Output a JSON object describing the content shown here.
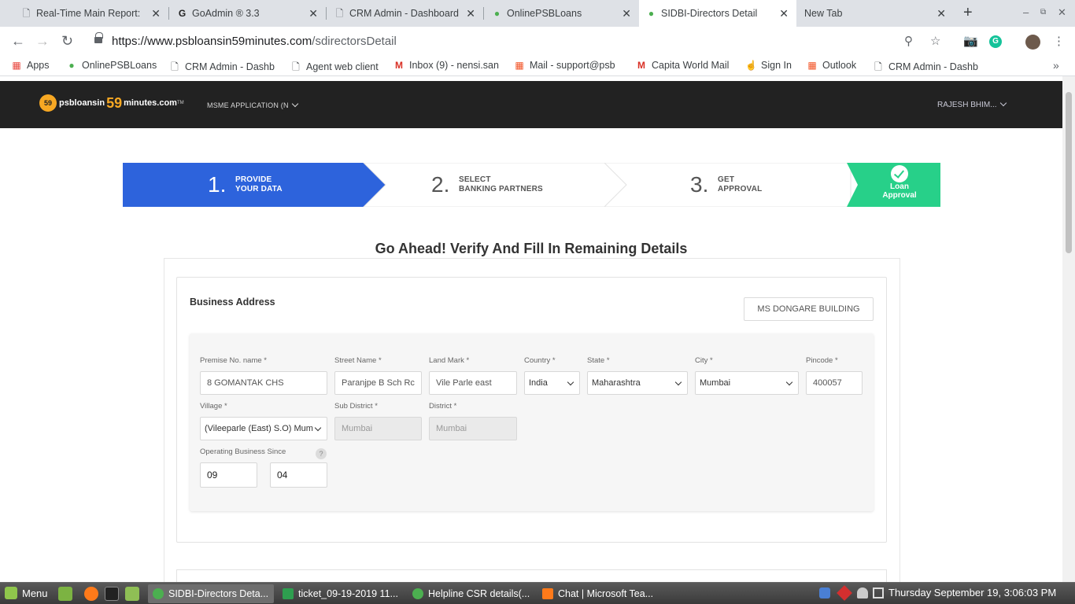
{
  "browser": {
    "tabs": [
      {
        "title": "Real-Time Main Report: ",
        "icon": "page-icon"
      },
      {
        "title": "GoAdmin ® 3.3",
        "icon": "goadmin-icon"
      },
      {
        "title": "CRM Admin - Dashboard",
        "icon": "page-icon"
      },
      {
        "title": "OnlinePSBLoans",
        "icon": "psb-icon"
      },
      {
        "title": "SIDBI-Directors Detail",
        "icon": "psb-icon"
      },
      {
        "title": "New Tab",
        "icon": ""
      }
    ],
    "url_host": "https://www.psbloansin59minutes.com",
    "url_path": "/sdirectorsDetail",
    "bookmarks": [
      {
        "label": "Apps"
      },
      {
        "label": "OnlinePSBLoans"
      },
      {
        "label": "CRM Admin - Dashb"
      },
      {
        "label": "Agent web client"
      },
      {
        "label": "Inbox (9) - nensi.san"
      },
      {
        "label": "Mail - support@psb"
      },
      {
        "label": "Capita World Mail"
      },
      {
        "label": "Sign In"
      },
      {
        "label": "Outlook"
      },
      {
        "label": "CRM Admin - Dashb"
      }
    ]
  },
  "site": {
    "logo": {
      "badge": "59",
      "pre": "psbloansin",
      "num": "59",
      "post": "minutes.com",
      "tm": "TM"
    },
    "app_menu": "MSME APPLICATION (N",
    "user_menu": "RAJESH BHIM..."
  },
  "steps": [
    {
      "num": "1.",
      "line1": "PROVIDE",
      "line2": "YOUR DATA",
      "state": "active"
    },
    {
      "num": "2.",
      "line1": "SELECT",
      "line2": "BANKING PARTNERS",
      "state": "pending"
    },
    {
      "num": "3.",
      "line1": "GET",
      "line2": "APPROVAL",
      "state": "pending"
    }
  ],
  "final_step": {
    "line1": "Loan",
    "line2": "Approval"
  },
  "page_title": "Go Ahead! Verify And Fill In Remaining Details",
  "business_address": {
    "title": "Business Address",
    "chip": "MS DONGARE BUILDING",
    "fields": {
      "premise": {
        "label": "Premise No. name *",
        "value": "8 GOMANTAK CHS"
      },
      "street": {
        "label": "Street Name *",
        "value": "Paranjpe B Sch Rc"
      },
      "landmark": {
        "label": "Land Mark *",
        "value": "Vile Parle east"
      },
      "country": {
        "label": "Country *",
        "value": "India"
      },
      "state": {
        "label": "State *",
        "value": "Maharashtra"
      },
      "city": {
        "label": "City *",
        "value": "Mumbai"
      },
      "pincode": {
        "label": "Pincode *",
        "value": "400057"
      },
      "village": {
        "label": "Village *",
        "value": "(Vileeparle (East) S.O) Mum"
      },
      "sub_district": {
        "label": "Sub District *",
        "value": "Mumbai"
      },
      "district": {
        "label": "District *",
        "value": "Mumbai"
      },
      "operating_since": {
        "label": "Operating Business Since",
        "month": "09",
        "year": "04",
        "help": "?"
      }
    }
  },
  "taskbar": {
    "menu": "Menu",
    "tasks": [
      {
        "label": "SIDBI-Directors Deta...",
        "active": true
      },
      {
        "label": "ticket_09-19-2019 11...",
        "active": false
      },
      {
        "label": "Helpline CSR details(...",
        "active": false
      },
      {
        "label": "Chat | Microsoft Tea...",
        "active": false
      }
    ],
    "clock": "Thursday September 19,  3:06:03 PM"
  },
  "colors": {
    "step_active": "#2d63dc",
    "step_final": "#27d089",
    "header_bg": "#222222",
    "logo_accent": "#f7a823"
  }
}
